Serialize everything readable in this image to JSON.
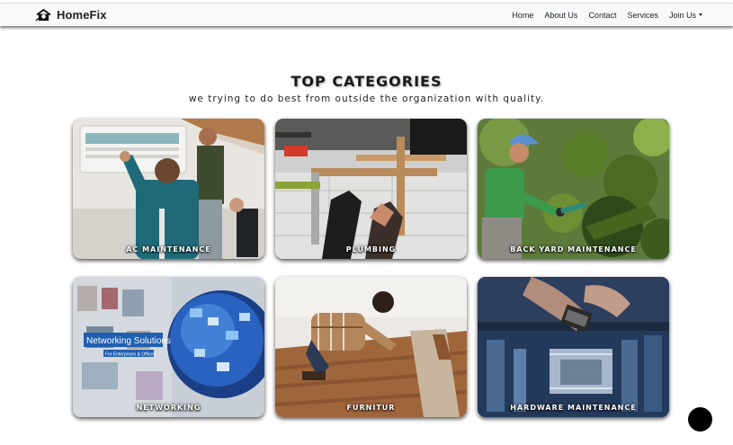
{
  "nav": {
    "brand": "HomeFix",
    "links": [
      "Home",
      "About Us",
      "Contact",
      "Services",
      "Join Us"
    ]
  },
  "section": {
    "title": "TOP CATEGORIES",
    "subtitle": "we trying to do best from outside the organization with quality."
  },
  "categories": [
    {
      "label": "AC MAINTENANCE",
      "image": "ac-technicians-photo"
    },
    {
      "label": "PLUMBING",
      "image": "plumbing-pipes-photo"
    },
    {
      "label": "BACK YARD MAINTENANCE",
      "image": "gardener-trimming-photo"
    },
    {
      "label": "NETWORKING",
      "image": "networking-globe-photo",
      "image_text": {
        "title": "Networking Solutions",
        "caption": "For Enterprises & Offices"
      }
    },
    {
      "label": "FURNITUR",
      "image": "floor-laying-photo"
    },
    {
      "label": "HARDWARE MAINTENANCE",
      "image": "circuit-board-chip-photo"
    }
  ],
  "colors": {
    "navbar_bg": "#f8f9fa",
    "title": "#1a1a1a",
    "card_label": "#ffffff",
    "fab": "#000000"
  }
}
